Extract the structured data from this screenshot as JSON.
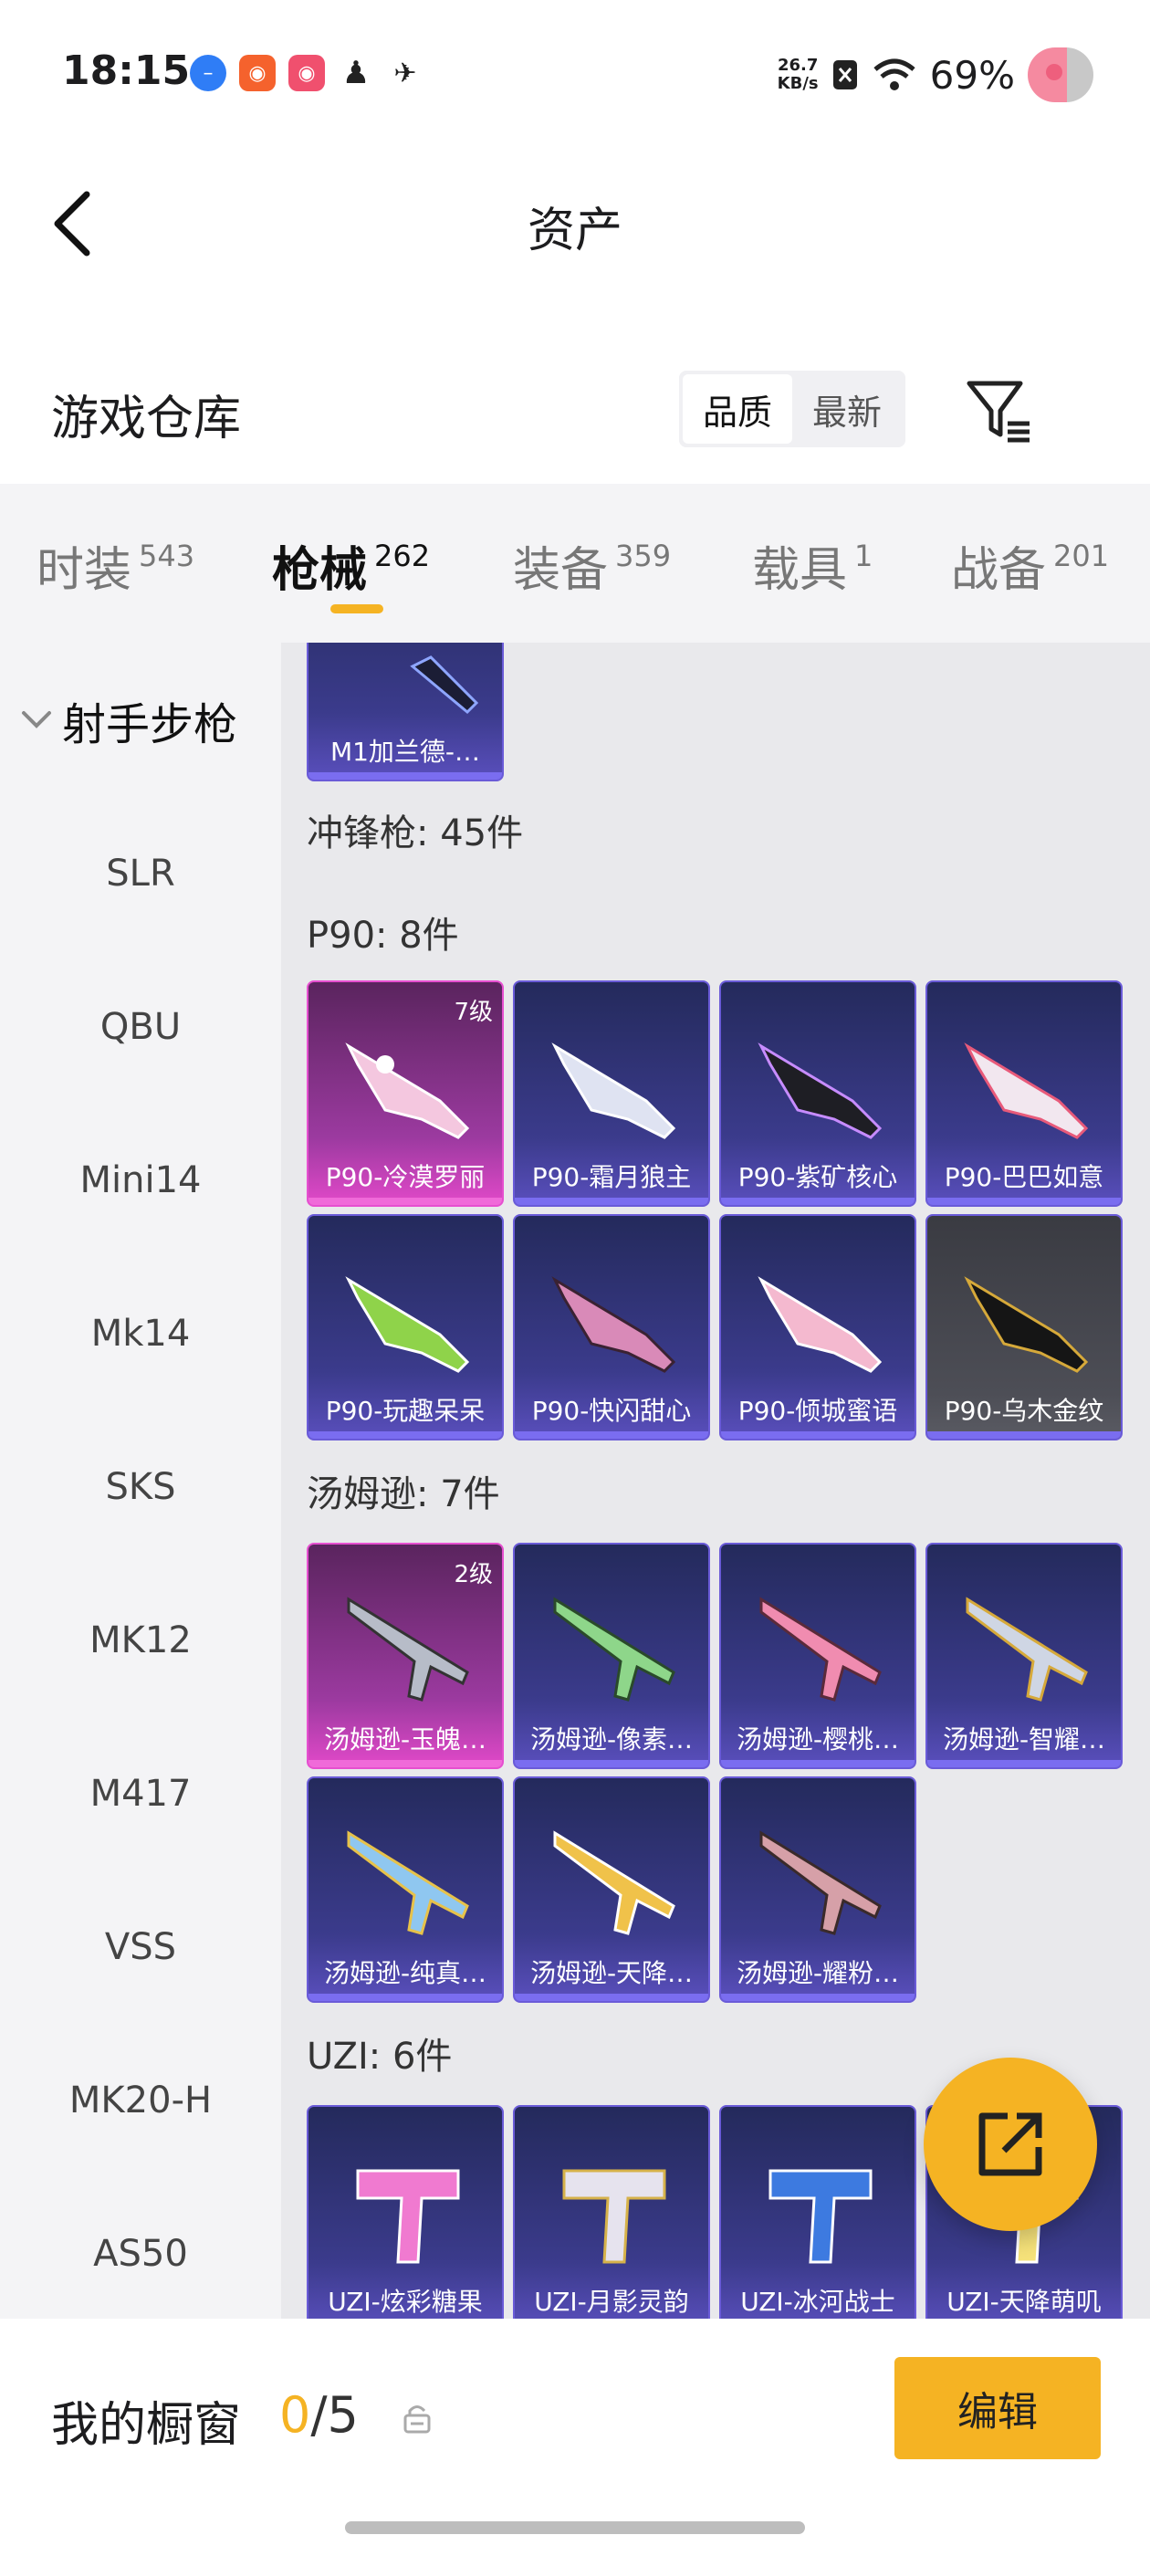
{
  "status_bar": {
    "time": "18:15",
    "net_speed_value": "26.7",
    "net_speed_unit": "KB/s",
    "battery": "69%"
  },
  "header": {
    "title": "资产"
  },
  "warehouse": {
    "title": "游戏仓库",
    "sort_options": [
      "品质",
      "最新"
    ],
    "active_sort": "品质"
  },
  "tabs": [
    {
      "label": "时装",
      "count": "543"
    },
    {
      "label": "枪械",
      "count": "262"
    },
    {
      "label": "装备",
      "count": "359"
    },
    {
      "label": "载具",
      "count": "1"
    },
    {
      "label": "战备",
      "count": "201"
    }
  ],
  "active_tab": "枪械",
  "sidebar": {
    "group": "射手步枪",
    "items": [
      "SLR",
      "QBU",
      "Mini14",
      "Mk14",
      "SKS",
      "MK12",
      "M417",
      "VSS",
      "MK20-H",
      "AS50"
    ]
  },
  "content": {
    "top_card": "M1加兰德-…",
    "category_label": "冲锋枪: 45件",
    "groups": [
      {
        "label": "P90: 8件",
        "items": [
          {
            "name": "P90-冷漠罗丽",
            "level": "7级",
            "style": "pink"
          },
          {
            "name": "P90-霜月狼主",
            "level": "",
            "style": "purple"
          },
          {
            "name": "P90-紫矿核心",
            "level": "",
            "style": "purple"
          },
          {
            "name": "P90-巴巴如意",
            "level": "",
            "style": "purple"
          },
          {
            "name": "P90-玩趣呆呆",
            "level": "",
            "style": "purple"
          },
          {
            "name": "P90-快闪甜心",
            "level": "",
            "style": "purple"
          },
          {
            "name": "P90-倾城蜜语",
            "level": "",
            "style": "purple"
          },
          {
            "name": "P90-乌木金纹",
            "level": "",
            "style": "gray"
          }
        ]
      },
      {
        "label": "汤姆逊: 7件",
        "items": [
          {
            "name": "汤姆逊-玉魄…",
            "level": "2级",
            "style": "pink"
          },
          {
            "name": "汤姆逊-像素…",
            "level": "",
            "style": "purple"
          },
          {
            "name": "汤姆逊-樱桃…",
            "level": "",
            "style": "purple"
          },
          {
            "name": "汤姆逊-智耀…",
            "level": "",
            "style": "purple"
          },
          {
            "name": "汤姆逊-纯真…",
            "level": "",
            "style": "purple"
          },
          {
            "name": "汤姆逊-天降…",
            "level": "",
            "style": "purple"
          },
          {
            "name": "汤姆逊-耀粉…",
            "level": "",
            "style": "purple"
          }
        ]
      },
      {
        "label": "UZI: 6件",
        "items": [
          {
            "name": "UZI-炫彩糖果",
            "level": "",
            "style": "purple"
          },
          {
            "name": "UZI-月影灵韵",
            "level": "",
            "style": "purple"
          },
          {
            "name": "UZI-冰河战士",
            "level": "",
            "style": "purple"
          },
          {
            "name": "UZI-天降萌叽",
            "level": "",
            "style": "purple"
          }
        ]
      }
    ]
  },
  "bottom": {
    "showcase_label": "我的橱窗",
    "showcase_current": "0",
    "showcase_total": "/5",
    "edit_label": "编辑"
  },
  "colors": {
    "accent": "#f5b323",
    "card_purple": "#3b3b8c",
    "card_pink": "#9c3aa0"
  }
}
